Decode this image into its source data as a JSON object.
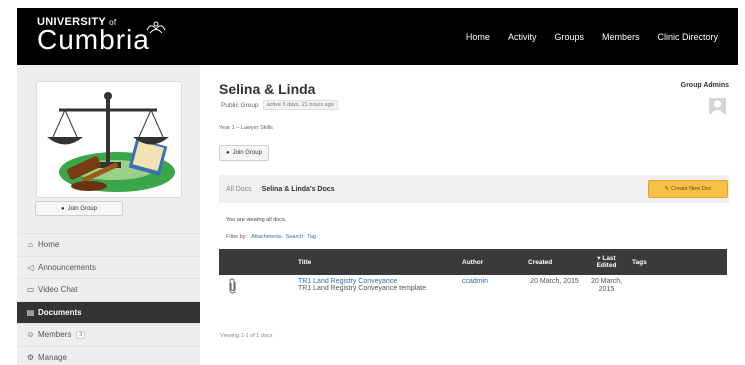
{
  "brand": {
    "university": "UNIVERSITY",
    "of": "of",
    "name": "Cumbria"
  },
  "nav": [
    "Home",
    "Activity",
    "Groups",
    "Members",
    "Clinic Directory"
  ],
  "sidebar": {
    "join_label": "Join Group",
    "items": [
      {
        "icon": "home-icon",
        "glyph": "⌂",
        "label": "Home",
        "active": false
      },
      {
        "icon": "megaphone-icon",
        "glyph": "📣",
        "label": "Announcements",
        "active": false
      },
      {
        "icon": "video-icon",
        "glyph": "▭",
        "label": "Video Chat",
        "active": false
      },
      {
        "icon": "documents-icon",
        "glyph": "▤",
        "label": "Documents",
        "active": true
      },
      {
        "icon": "members-icon",
        "glyph": "👥",
        "label": "Members",
        "count": "3",
        "active": false
      },
      {
        "icon": "gear-icon",
        "glyph": "⚙",
        "label": "Manage",
        "active": false
      }
    ]
  },
  "group": {
    "title": "Selina & Linda",
    "type": "Public Group",
    "active": "active 3 days, 21 hours ago",
    "description": "Year 1 – Lawyer Skills",
    "join_label": "Join Group",
    "admins_label": "Group Admins"
  },
  "docs": {
    "tabs": [
      "All Docs",
      "Selina & Linda's Docs"
    ],
    "create_label": "Create New Doc",
    "viewing_text": "You are viewing all docs.",
    "filter_label": "Filter by:",
    "filters": [
      "Attachments",
      "Search",
      "Tag"
    ],
    "columns": {
      "title": "Title",
      "author": "Author",
      "created": "Created",
      "edited_line1": "Last",
      "edited_line2": "Edited",
      "tags": "Tags"
    },
    "rows": [
      {
        "title": "TR1 Land Registry Conveyance",
        "excerpt": "TR1 Land Registry Conveyance template.",
        "author": "ccadmin",
        "created": "20 March, 2015",
        "edited": "20 March, 2015",
        "tags": ""
      }
    ],
    "count_text": "Viewing 1-1 of 1 docs"
  }
}
